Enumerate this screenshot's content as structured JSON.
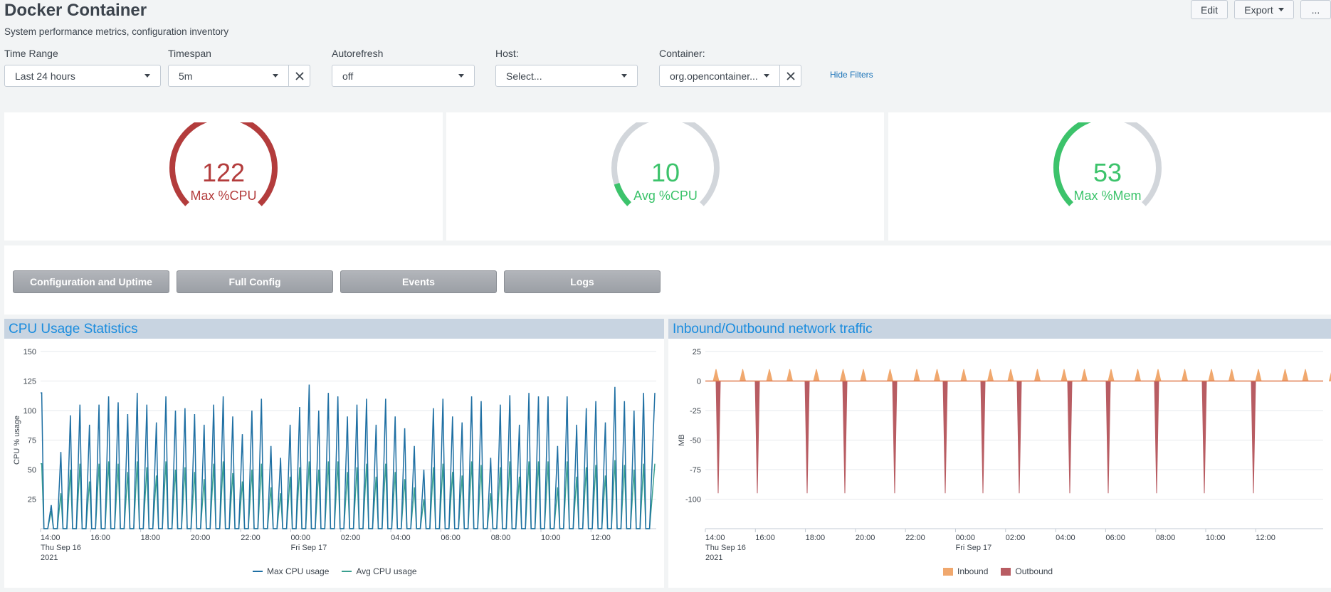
{
  "page": {
    "title": "Docker Container",
    "description": "System performance metrics, configuration inventory"
  },
  "toolbar": {
    "edit_label": "Edit",
    "export_label": "Export",
    "more_label": "..."
  },
  "filters": {
    "time_range": {
      "label": "Time Range",
      "value": "Last 24 hours"
    },
    "timespan": {
      "label": "Timespan",
      "value": "5m"
    },
    "autorefresh": {
      "label": "Autorefresh",
      "value": "off"
    },
    "host": {
      "label": "Host:",
      "value": "Select..."
    },
    "container": {
      "label": "Container:",
      "value": "org.opencontainer..."
    },
    "hide_filters_label": "Hide Filters"
  },
  "gauges": [
    {
      "value": "122",
      "label": "Max %CPU",
      "color": "#b33c3c",
      "fill": 1.0
    },
    {
      "value": "10",
      "label": "Avg %CPU",
      "color": "#3cc36b",
      "fill": 0.1
    },
    {
      "value": "53",
      "label": "Max %Mem",
      "color": "#3cc36b",
      "fill": 0.53
    }
  ],
  "gauge_track_color": "#d2d6db",
  "nav_buttons": [
    "Configuration and Uptime",
    "Full Config",
    "Events",
    "Logs"
  ],
  "panels": {
    "cpu": {
      "title": "CPU Usage Statistics"
    },
    "net": {
      "title": "Inbound/Outbound network traffic"
    }
  },
  "chart_data": [
    {
      "type": "line",
      "title": "CPU Usage Statistics",
      "ylabel": "CPU % usage",
      "xlabel": "",
      "ylim": [
        0,
        150
      ],
      "y_ticks": [
        "150",
        "125",
        "100",
        "75",
        "50",
        "25"
      ],
      "x_ticks": [
        "14:00",
        "16:00",
        "18:00",
        "20:00",
        "22:00",
        "00:00",
        "02:00",
        "04:00",
        "06:00",
        "08:00",
        "10:00",
        "12:00"
      ],
      "x_sub_first": [
        "Thu Sep 16",
        "2021"
      ],
      "x_sub_midnight": "Fri Sep 17",
      "series": [
        {
          "name": "Max CPU usage",
          "color": "#1e6fa3",
          "peaks": [
            115,
            20,
            65,
            96,
            105,
            88,
            105,
            112,
            107,
            97,
            115,
            105,
            90,
            112,
            100,
            102,
            97,
            88,
            105,
            112,
            95,
            80,
            100,
            110,
            70,
            60,
            88,
            103,
            122,
            100,
            115,
            112,
            95,
            105,
            110,
            88,
            110,
            95,
            85,
            70,
            50,
            102,
            110,
            95,
            90,
            112,
            108,
            60,
            105,
            113,
            88,
            115,
            112,
            112,
            70,
            112,
            88,
            102,
            108,
            90,
            120,
            108,
            100,
            115
          ]
        },
        {
          "name": "Avg CPU usage",
          "color": "#3a9f8f",
          "peaks": [
            55,
            15,
            30,
            50,
            55,
            40,
            55,
            57,
            55,
            48,
            57,
            52,
            45,
            57,
            50,
            52,
            48,
            42,
            55,
            57,
            47,
            40,
            50,
            55,
            35,
            30,
            44,
            52,
            57,
            50,
            57,
            57,
            48,
            52,
            55,
            44,
            55,
            48,
            42,
            35,
            25,
            52,
            55,
            48,
            45,
            57,
            54,
            30,
            52,
            57,
            44,
            57,
            57,
            57,
            35,
            57,
            44,
            52,
            54,
            45,
            58,
            54,
            50,
            55
          ]
        }
      ]
    },
    {
      "type": "area",
      "title": "Inbound/Outbound network traffic",
      "ylabel": "MB",
      "xlabel": "",
      "ylim": [
        -125,
        25
      ],
      "y_ticks": [
        "25",
        "0",
        "-25",
        "-50",
        "-75",
        "-100"
      ],
      "x_ticks": [
        "14:00",
        "16:00",
        "18:00",
        "20:00",
        "22:00",
        "00:00",
        "02:00",
        "04:00",
        "06:00",
        "08:00",
        "10:00",
        "12:00"
      ],
      "x_sub_first": [
        "Thu Sep 16",
        "2021"
      ],
      "x_sub_midnight": "Fri Sep 17",
      "series": [
        {
          "name": "Inbound",
          "color": "#f0a86e",
          "spike_value": 10
        },
        {
          "name": "Outbound",
          "color": "#b85c62",
          "spike_value": -95
        }
      ]
    }
  ]
}
